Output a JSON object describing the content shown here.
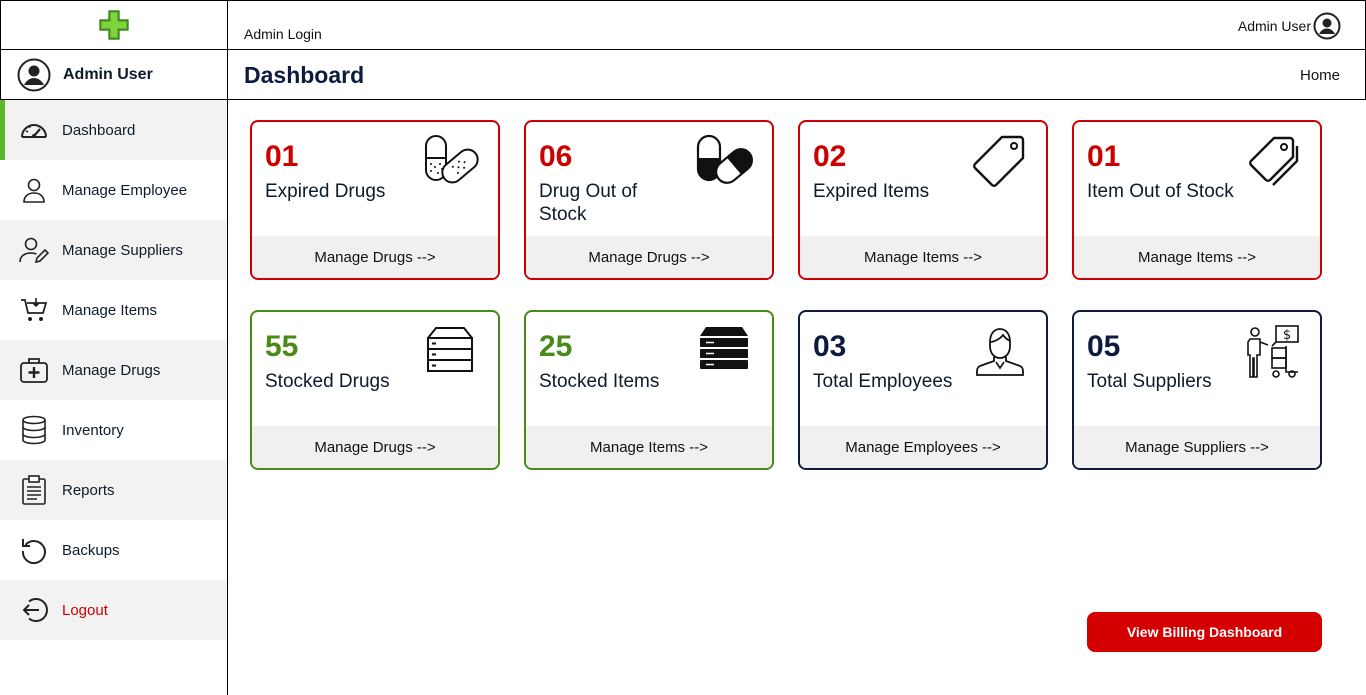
{
  "header": {
    "breadcrumb": "Admin Login",
    "user_name": "Admin User"
  },
  "sidebar_user": {
    "name": "Admin User"
  },
  "page": {
    "title": "Dashboard",
    "home_link": "Home"
  },
  "sidebar": {
    "items": [
      {
        "label": "Dashboard",
        "icon": "speedometer-icon"
      },
      {
        "label": "Manage Employee",
        "icon": "user-icon"
      },
      {
        "label": "Manage Suppliers",
        "icon": "user-edit-icon"
      },
      {
        "label": "Manage Items",
        "icon": "cart-icon"
      },
      {
        "label": "Manage Drugs",
        "icon": "medical-kit-icon"
      },
      {
        "label": "Inventory",
        "icon": "database-icon"
      },
      {
        "label": "Reports",
        "icon": "clipboard-icon"
      },
      {
        "label": "Backups",
        "icon": "restore-icon"
      },
      {
        "label": "Logout",
        "icon": "logout-icon"
      }
    ]
  },
  "cards": [
    {
      "count": "01",
      "label": "Expired Drugs",
      "link": "Manage Drugs -->",
      "icon": "pills-icon"
    },
    {
      "count": "06",
      "label": "Drug Out of Stock",
      "link": "Manage Drugs -->",
      "icon": "capsule-icon"
    },
    {
      "count": "02",
      "label": "Expired Items",
      "link": "Manage Items -->",
      "icon": "tag-icon"
    },
    {
      "count": "01",
      "label": "Item Out of Stock",
      "link": "Manage Items -->",
      "icon": "tags-icon"
    },
    {
      "count": "55",
      "label": "Stocked Drugs",
      "link": "Manage Drugs -->",
      "icon": "storage-icon"
    },
    {
      "count": "25",
      "label": "Stocked Items",
      "link": "Manage Items -->",
      "icon": "server-stack-icon"
    },
    {
      "count": "03",
      "label": "Total Employees",
      "link": "Manage Employees -->",
      "icon": "employee-icon"
    },
    {
      "count": "05",
      "label": "Total Suppliers",
      "link": "Manage Suppliers -->",
      "icon": "supplier-icon"
    }
  ],
  "billing_button": "View Billing Dashboard",
  "colors": {
    "alert_red": "#cc0000",
    "stock_green": "#4a8a16",
    "navy": "#0d1b3e",
    "active_indicator": "#5cb82a",
    "button_red": "#d40000"
  }
}
